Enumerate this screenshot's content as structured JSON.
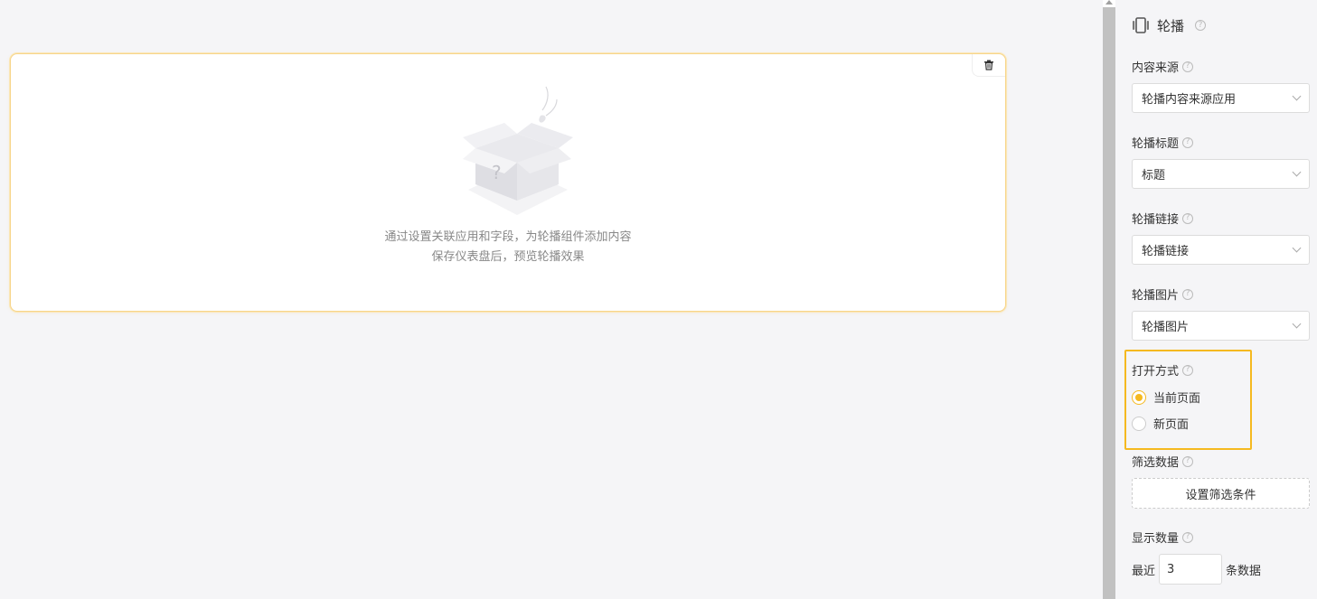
{
  "canvas": {
    "hint_line1": "通过设置关联应用和字段，为轮播组件添加内容",
    "hint_line2": "保存仪表盘后，预览轮播效果"
  },
  "panel": {
    "title": "轮播",
    "content_source": {
      "label": "内容来源",
      "value": "轮播内容来源应用"
    },
    "carousel_title": {
      "label": "轮播标题",
      "value": "标题"
    },
    "carousel_link": {
      "label": "轮播链接",
      "value": "轮播链接"
    },
    "carousel_image": {
      "label": "轮播图片",
      "value": "轮播图片"
    },
    "open_mode": {
      "label": "打开方式",
      "options": [
        "当前页面",
        "新页面"
      ],
      "selected": "当前页面"
    },
    "filter": {
      "label": "筛选数据",
      "button_label": "设置筛选条件"
    },
    "display_count": {
      "label": "显示数量",
      "prefix": "最近",
      "value": "3",
      "suffix": "条数据"
    }
  },
  "colors": {
    "accent": "#f5b920",
    "card_border": "#f7d58a"
  }
}
